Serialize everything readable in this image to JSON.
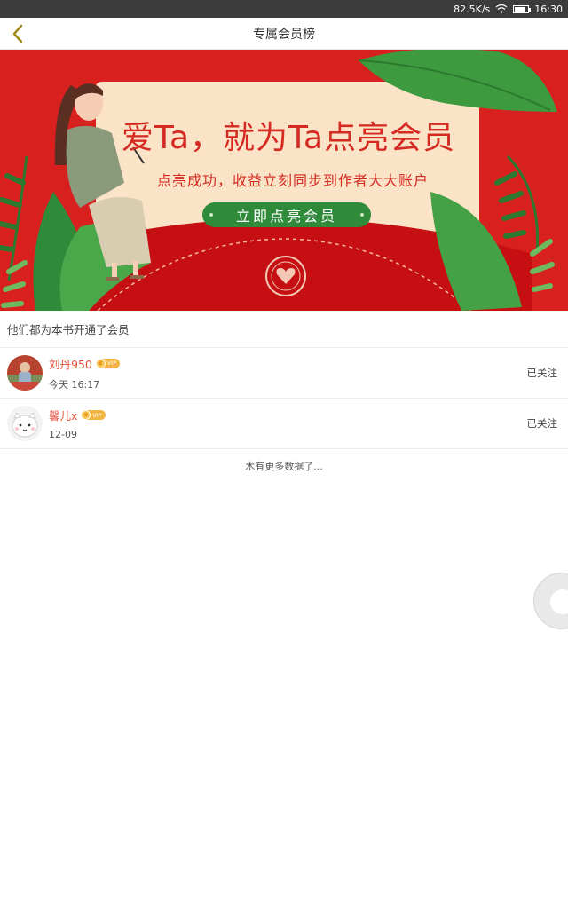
{
  "status_bar": {
    "speed": "82.5K/s",
    "time": "16:30"
  },
  "nav": {
    "title": "专属会员榜"
  },
  "banner": {
    "headline": "爱Ta，就为Ta点亮会员",
    "subline": "点亮成功，收益立刻同步到作者大大账户",
    "cta": "立即点亮会员"
  },
  "section": {
    "title": "他们都为本书开通了会员"
  },
  "members": [
    {
      "name": "刘丹950",
      "badge": "VIP",
      "time": "今天 16:17",
      "follow": "已关注"
    },
    {
      "name": "馨儿x",
      "badge": "VIP",
      "time": "12-09",
      "follow": "已关注"
    }
  ],
  "footer": {
    "no_more": "木有更多数据了..."
  },
  "colors": {
    "brand_red": "#d8201f",
    "name_color": "#e8513c",
    "cta_green": "#2f8a3a"
  }
}
